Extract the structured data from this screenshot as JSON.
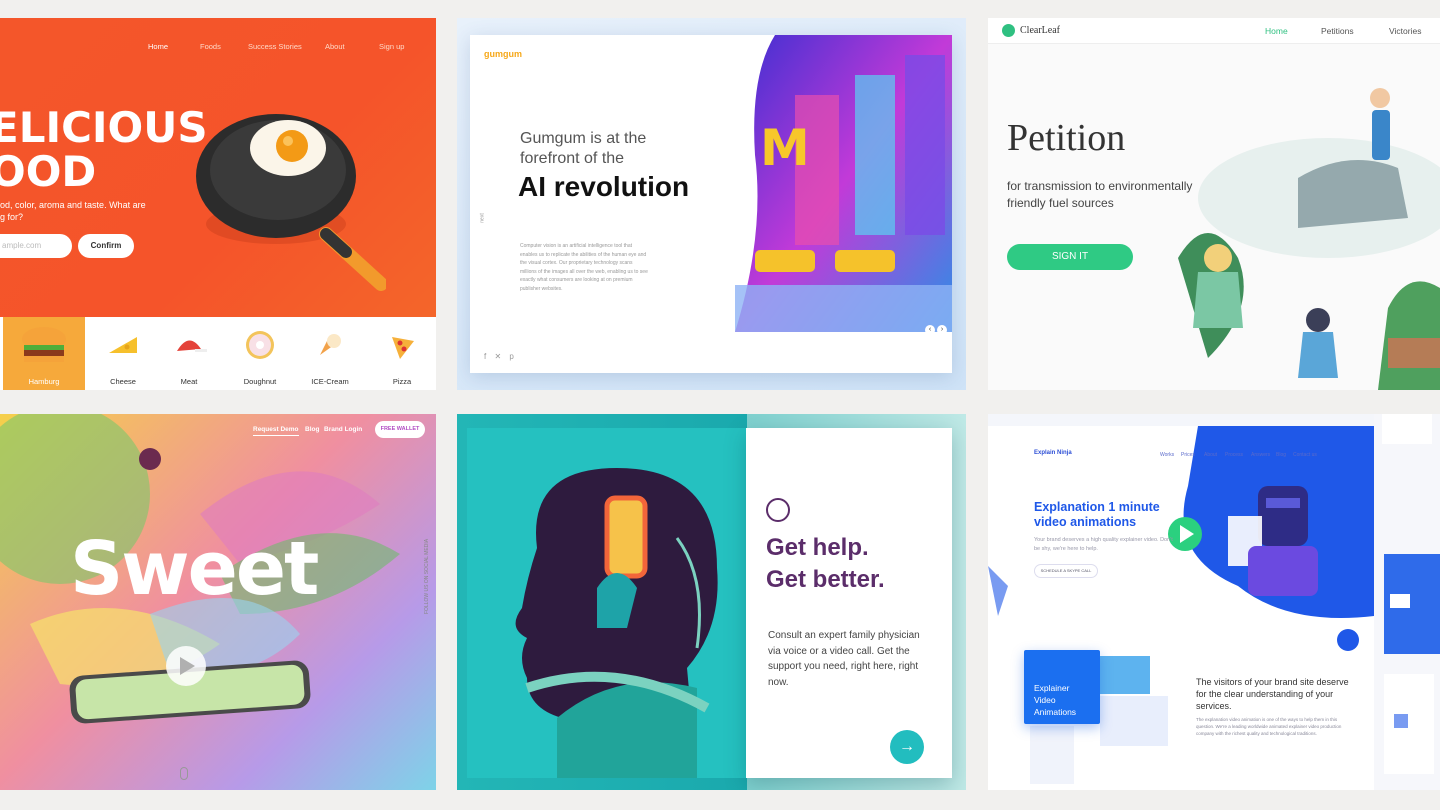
{
  "food": {
    "nav": [
      "Home",
      "Foods",
      "Success Stories",
      "About",
      "Sign up"
    ],
    "headline_1": "ELICIOUS",
    "headline_2": "OOD",
    "subtitle_1": "od, color, aroma and taste. What are",
    "subtitle_2": "g for?",
    "email_placeholder": "ample.com",
    "confirm_label": "Confirm",
    "items": [
      "Hamburg",
      "Cheese",
      "Meat",
      "Doughnut",
      "ICE-Cream",
      "Pizza"
    ],
    "accent": "#f4562a"
  },
  "gumgum": {
    "logo": "gumgum",
    "tag_1": "Gumgum is at the",
    "tag_2": "forefront of the",
    "headline": "AI revolution",
    "body": "Computer vision is an artificial intelligence tool that enables us to replicate the abilities of the human eye and the visual cortex. Our proprietary technology scans millions of the images all over the web, enabling us to see exactly what consumers are looking at on premium publisher websites.",
    "social": "f  ✕  p",
    "vertical": "next",
    "prev_arrow": "‹",
    "next_arrow": "›"
  },
  "clearleaf": {
    "logo": "ClearLeaf",
    "nav": [
      "Home",
      "Petitions",
      "Victories"
    ],
    "title": "Petition",
    "sub_1": "for transmission to environmentally",
    "sub_2": "friendly fuel sources",
    "button": "SIGN IT",
    "accent": "#2fca84"
  },
  "sweet": {
    "nav": [
      "Request Demo",
      "Blog",
      "Brand Login"
    ],
    "wallet": "FREE WALLET",
    "word": "Sweet",
    "side_text": "FOLLOW US ON SOCIAL MEDIA"
  },
  "help": {
    "h_1": "Get help.",
    "h_2": "Get better.",
    "body": "Consult an expert family physician via voice or a video call. Get the support you need, right here, right now.",
    "go": "→",
    "accent": "#5b2d6a"
  },
  "ninja": {
    "logo": "Explain Ninja",
    "nav": [
      "Works",
      "Prices",
      "About",
      "Process",
      "Answers",
      "Blog",
      "Contact us"
    ],
    "headline": "Explanation 1 minute video animations",
    "body": "Your brand deserves a high quality explainer video. Don't be shy, we're here to help.",
    "cta": "SCHEDULE A SKYPE CALL",
    "card": "Explainer Video Animations",
    "visit": "The visitors of your brand site deserve for the clear understanding of your services.",
    "visit_body": "The explanation video animation is one of the ways to help them in this question. We're a leading worldwide animated explainer video production company with the richest quality and technological traditions.",
    "accent": "#1f58e8"
  }
}
